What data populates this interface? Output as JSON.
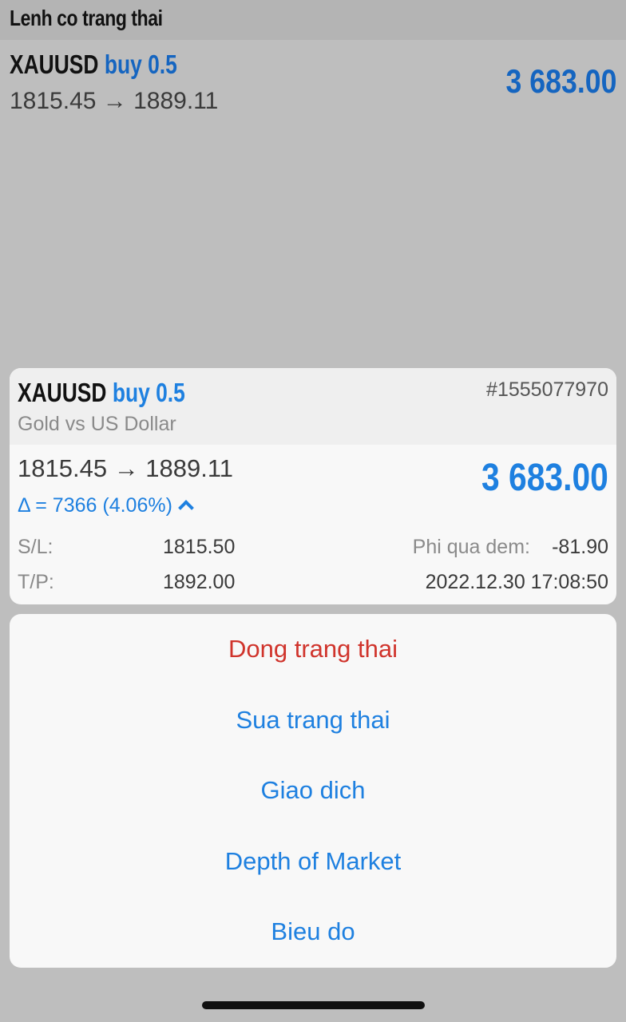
{
  "header": {
    "title": "Lenh co trang thai"
  },
  "background_position": {
    "symbol": "XAUUSD",
    "direction": "buy 0.5",
    "prices": "1815.45 → 1889.11",
    "profit": "3 683.00"
  },
  "card": {
    "symbol": "XAUUSD",
    "direction": "buy 0.5",
    "description": "Gold vs US Dollar",
    "ticket": "#1555077970",
    "prices": "1815.45 → 1889.11",
    "profit": "3 683.00",
    "delta": "Δ = 7366 (4.06%)",
    "sl_label": "S/L:",
    "sl_value": "1815.50",
    "tp_label": "T/P:",
    "tp_value": "1892.00",
    "swap_label": "Phi qua dem:",
    "swap_value": "-81.90",
    "open_time": "2022.12.30 17:08:50"
  },
  "actions": [
    {
      "label": "Dong trang thai",
      "style": "destructive"
    },
    {
      "label": "Sua trang thai"
    },
    {
      "label": "Giao dich"
    },
    {
      "label": "Depth of Market"
    },
    {
      "label": "Bieu do"
    }
  ],
  "colors": {
    "accent": "#1e80e0",
    "destructive": "#d0342c",
    "overlay_background": "#bebebe"
  }
}
